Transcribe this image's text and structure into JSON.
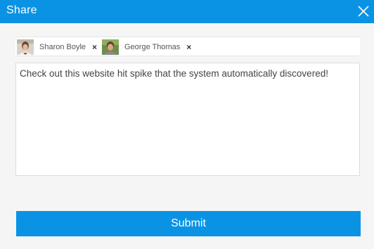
{
  "dialog": {
    "title": "Share",
    "accent_color": "#0a93e4",
    "close_icon": "close-icon"
  },
  "recipients": [
    {
      "name": "Sharon Boyle",
      "remove_symbol": "×",
      "avatar_icon": "avatar"
    },
    {
      "name": "George Thomas",
      "remove_symbol": "×",
      "avatar_icon": "avatar"
    }
  ],
  "message": {
    "value": "Check out this website hit spike that the system automatically discovered!"
  },
  "submit": {
    "label": "Submit"
  }
}
